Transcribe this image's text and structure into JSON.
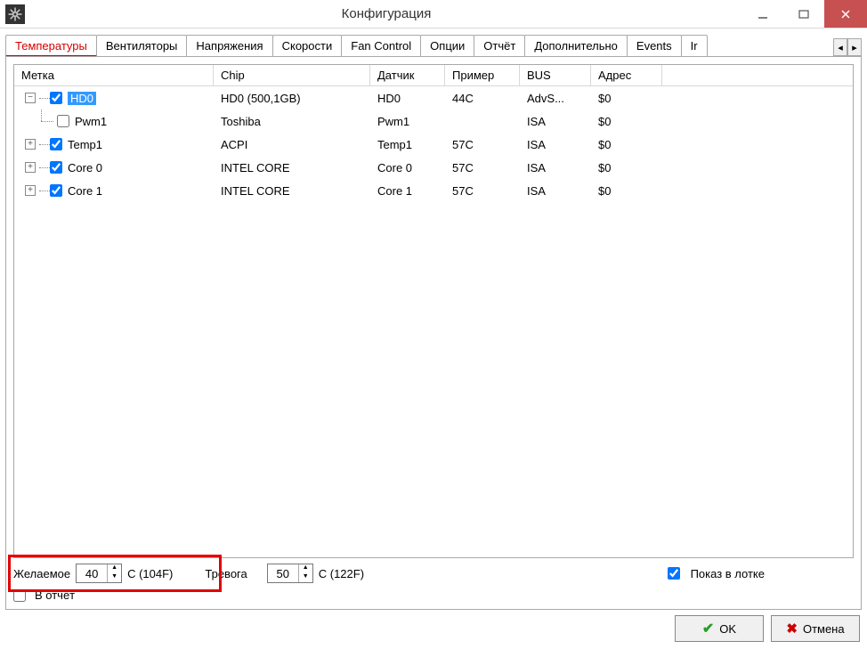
{
  "window": {
    "title": "Конфигурация"
  },
  "tabs": {
    "items": [
      "Температуры",
      "Вентиляторы",
      "Напряжения",
      "Скорости",
      "Fan Control",
      "Опции",
      "Отчёт",
      "Дополнительно",
      "Events",
      "Ir"
    ],
    "active": 0
  },
  "columns": {
    "label": "Метка",
    "chip": "Chip",
    "sensor": "Датчик",
    "sample": "Пример",
    "bus": "BUS",
    "addr": "Адрес"
  },
  "rows": [
    {
      "indent": 0,
      "expand": "-",
      "checked": true,
      "label": "HD0",
      "selected": true,
      "chip": "HD0 (500,1GB)",
      "sensor": "HD0",
      "sample": "44C",
      "bus": "AdvS...",
      "addr": "$0"
    },
    {
      "indent": 1,
      "expand": "",
      "checked": false,
      "label": "Pwm1",
      "selected": false,
      "chip": "Toshiba",
      "sensor": "Pwm1",
      "sample": "",
      "bus": "ISA",
      "addr": "$0"
    },
    {
      "indent": 0,
      "expand": "+",
      "checked": true,
      "label": "Temp1",
      "selected": false,
      "chip": "ACPI",
      "sensor": "Temp1",
      "sample": "57C",
      "bus": "ISA",
      "addr": "$0"
    },
    {
      "indent": 0,
      "expand": "+",
      "checked": true,
      "label": "Core 0",
      "selected": false,
      "chip": "INTEL CORE",
      "sensor": "Core 0",
      "sample": "57C",
      "bus": "ISA",
      "addr": "$0"
    },
    {
      "indent": 0,
      "expand": "+",
      "checked": true,
      "label": "Core 1",
      "selected": false,
      "chip": "INTEL CORE",
      "sensor": "Core 1",
      "sample": "57C",
      "bus": "ISA",
      "addr": "$0"
    }
  ],
  "desired": {
    "label": "Желаемое",
    "value": "40",
    "unit": "C (104F)"
  },
  "alarm": {
    "label": "Тревога",
    "value": "50",
    "unit": "C (122F)"
  },
  "tray": {
    "label": "Показ в лотке",
    "checked": true
  },
  "report": {
    "label": "В отчёт",
    "checked": false
  },
  "buttons": {
    "ok": "OK",
    "cancel": "Отмена"
  }
}
